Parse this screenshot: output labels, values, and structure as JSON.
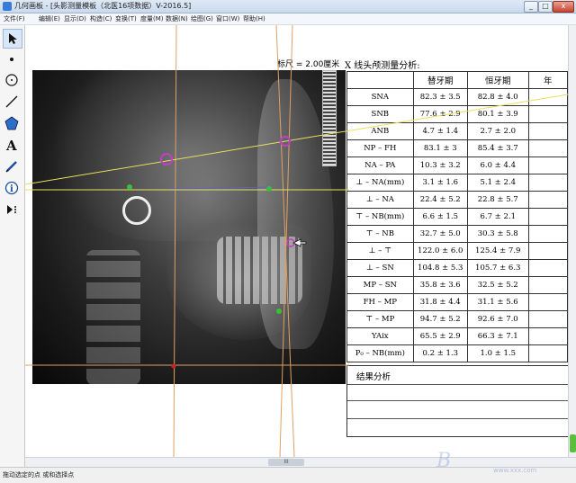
{
  "window": {
    "title": "几何画板 - [头影测量模板（北医16项数据）V-2016.5]",
    "buttons": {
      "minimize": "_",
      "maximize": "□",
      "close": "x"
    }
  },
  "menu": [
    "文件(F)",
    "编辑(E)",
    "显示(D)",
    "构造(C)",
    "变换(T)",
    "度量(M)",
    "数据(N)",
    "绘图(G)",
    "窗口(W)",
    "帮助(H)"
  ],
  "toolbar": {
    "tools": [
      "arrow-select-icon",
      "point-icon",
      "compass-circle-icon",
      "straightedge-icon",
      "polygon-icon",
      "text-icon",
      "marker-pen-icon",
      "information-icon",
      "custom-tool-icon"
    ]
  },
  "document": {
    "scale_label": "标尺 = 2.00厘米",
    "table_title": "X 线头颅测量分析:",
    "table": {
      "headers": [
        "",
        "替牙期",
        "恒牙期",
        "年"
      ],
      "rows": [
        [
          "SNA",
          "82.3 ± 3.5",
          "82.8 ± 4.0",
          ""
        ],
        [
          "SNB",
          "77.6 ± 2.9",
          "80.1 ± 3.9",
          ""
        ],
        [
          "ANB",
          "4.7 ± 1.4",
          "2.7 ± 2.0",
          ""
        ],
        [
          "NP – FH",
          "83.1 ± 3",
          "85.4 ± 3.7",
          ""
        ],
        [
          "NA – PA",
          "10.3 ± 3.2",
          "6.0 ± 4.4",
          ""
        ],
        [
          "⊥ – NA(mm)",
          "3.1 ± 1.6",
          "5.1 ± 2.4",
          ""
        ],
        [
          "⊥ – NA",
          "22.4 ± 5.2",
          "22.8 ± 5.7",
          ""
        ],
        [
          "⊤ – NB(mm)",
          "6.6 ± 1.5",
          "6.7 ± 2.1",
          ""
        ],
        [
          "⊤ – NB",
          "32.7 ± 5.0",
          "30.3 ± 5.8",
          ""
        ],
        [
          "⊥ – ⊤",
          "122.0 ± 6.0",
          "125.4 ± 7.9",
          ""
        ],
        [
          "⊥ – SN",
          "104.8 ± 5.3",
          "105.7 ± 6.3",
          ""
        ],
        [
          "MP – SN",
          "35.8 ± 3.6",
          "32.5 ± 5.2",
          ""
        ],
        [
          "FH – MP",
          "31.8 ± 4.4",
          "31.1 ± 5.6",
          ""
        ],
        [
          "⊤ – MP",
          "94.7 ± 5.2",
          "92.6 ± 7.0",
          ""
        ],
        [
          "YAix",
          "65.5 ± 2.9",
          "66.3 ± 7.1",
          ""
        ],
        [
          "P₀ – NB(mm)",
          "0.2 ± 1.3",
          "1.0 ± 1.5",
          ""
        ]
      ]
    },
    "result_label": "结果分析"
  },
  "scrollbar": {
    "h_thumb_label": "III"
  },
  "status_text": "拖动选定的点 或和选择点",
  "watermark": {
    "text": "B",
    "sub": "www.xxx.com"
  },
  "colors": {
    "guide_line_orange": "#e0a060",
    "guide_line_yellow": "#e8e060",
    "point_green": "#38c038",
    "point_magenta": "#c040c0",
    "point_red": "#d02020"
  }
}
